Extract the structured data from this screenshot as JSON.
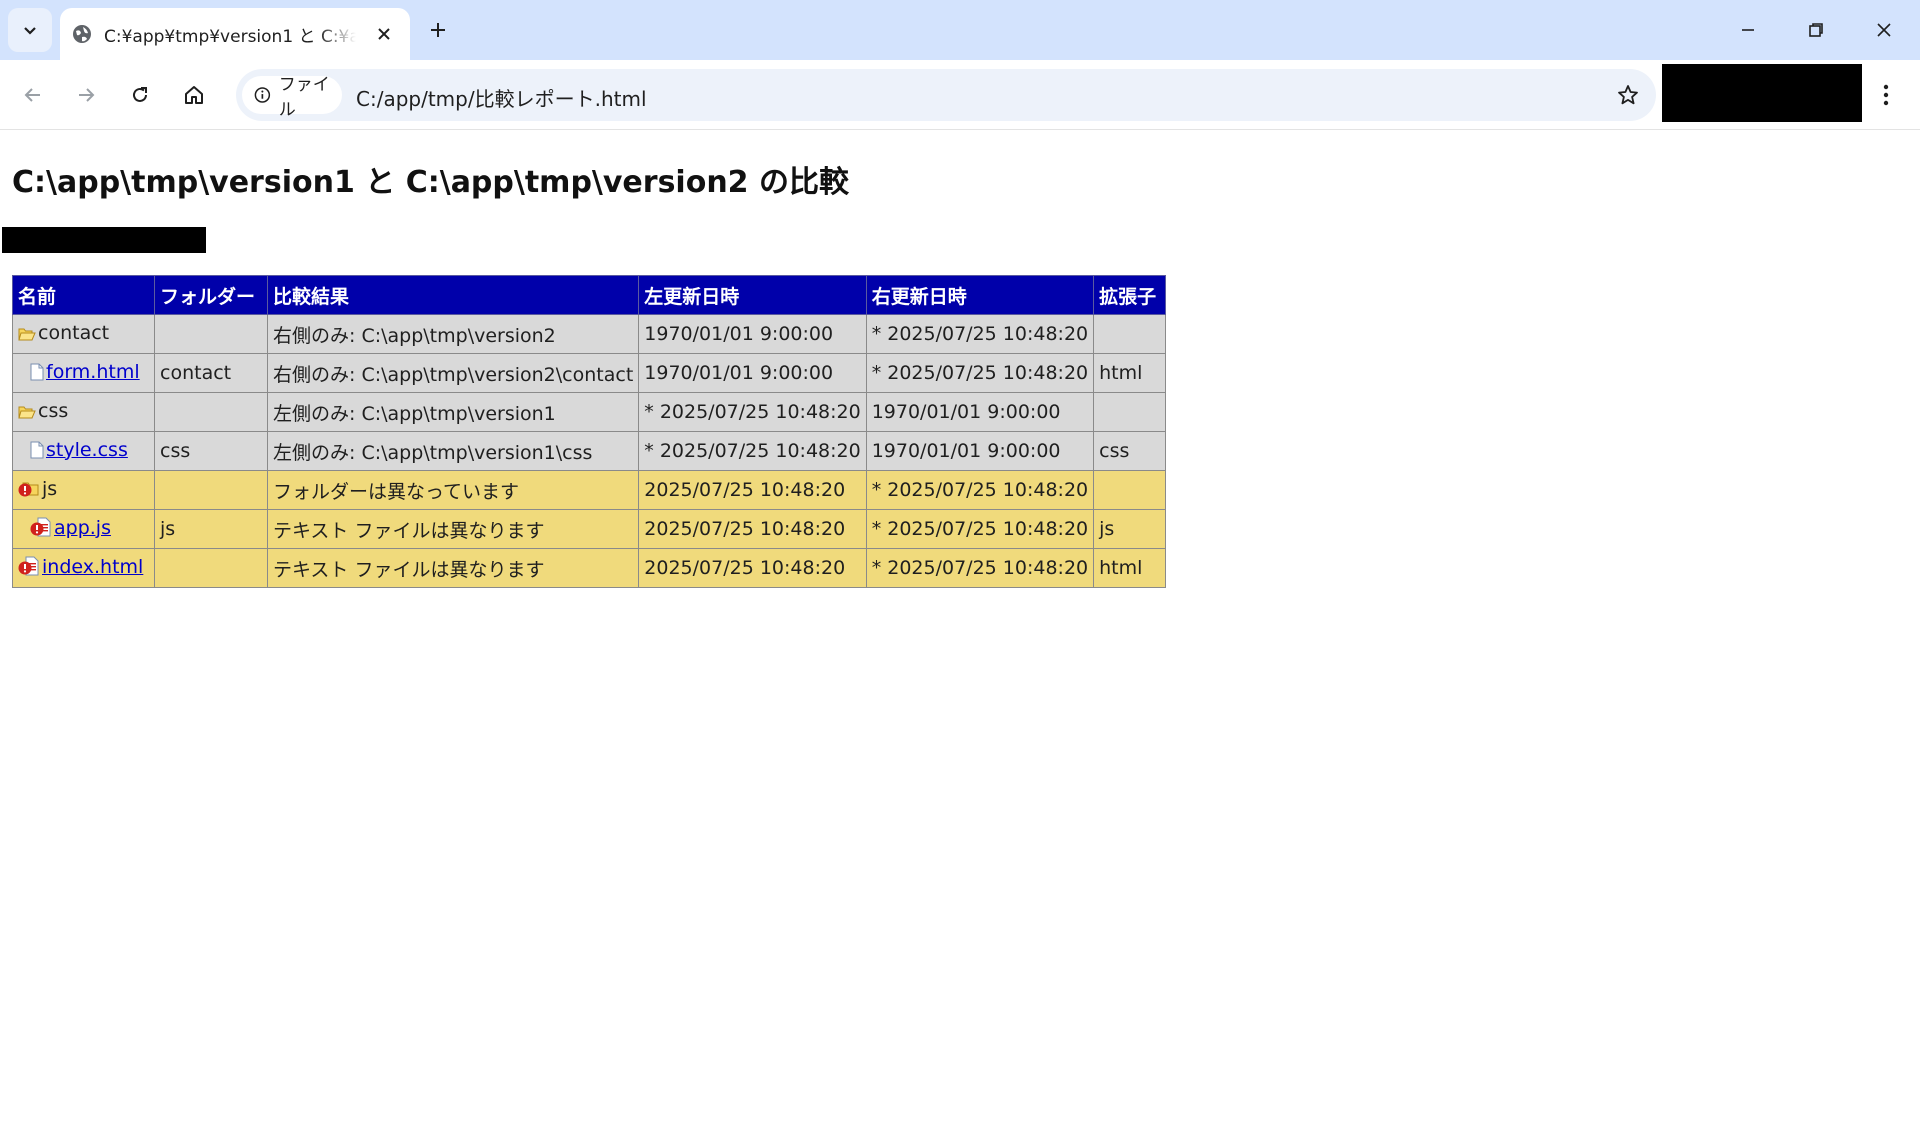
{
  "browser": {
    "tab_title": "C:¥app¥tmp¥version1 と C:¥app¥tmp¥version2 の比較",
    "chip_label": "ファイル",
    "url": "C:/app/tmp/比較レポート.html"
  },
  "page": {
    "heading": "C:\\app\\tmp\\version1 と C:\\app\\tmp\\version2 の比較"
  },
  "table": {
    "headers": [
      "名前",
      "フォルダー",
      "比較結果",
      "左更新日時",
      "右更新日時",
      "拡張子"
    ],
    "rows": [
      {
        "icon": "folder-open-icon",
        "indent": 0,
        "name": "contact",
        "link": false,
        "folder": "",
        "result": "右側のみ: C:\\app\\tmp\\version2",
        "left": "1970/01/01 9:00:00",
        "right": "* 2025/07/25 10:48:20",
        "ext": "",
        "status": "same"
      },
      {
        "icon": "file-icon",
        "indent": 1,
        "name": "form.html",
        "link": true,
        "folder": "contact",
        "result": "右側のみ: C:\\app\\tmp\\version2\\contact",
        "left": "1970/01/01 9:00:00",
        "right": "* 2025/07/25 10:48:20",
        "ext": "html",
        "status": "same"
      },
      {
        "icon": "folder-open-icon",
        "indent": 0,
        "name": "css",
        "link": false,
        "folder": "",
        "result": "左側のみ: C:\\app\\tmp\\version1",
        "left": "* 2025/07/25 10:48:20",
        "right": "1970/01/01 9:00:00",
        "ext": "",
        "status": "same"
      },
      {
        "icon": "file-icon",
        "indent": 1,
        "name": "style.css",
        "link": true,
        "folder": "css",
        "result": "左側のみ: C:\\app\\tmp\\version1\\css",
        "left": "* 2025/07/25 10:48:20",
        "right": "1970/01/01 9:00:00",
        "ext": "css",
        "status": "same"
      },
      {
        "icon": "folder-diff-icon",
        "indent": 0,
        "name": "js",
        "link": false,
        "folder": "",
        "result": "フォルダーは異なっています",
        "left": "2025/07/25 10:48:20",
        "right": "* 2025/07/25 10:48:20",
        "ext": "",
        "status": "diff"
      },
      {
        "icon": "file-diff-icon",
        "indent": 1,
        "name": "app.js",
        "link": true,
        "folder": "js",
        "result": "テキスト ファイルは異なります",
        "left": "2025/07/25 10:48:20",
        "right": "* 2025/07/25 10:48:20",
        "ext": "js",
        "status": "diff"
      },
      {
        "icon": "file-diff-icon",
        "indent": 0,
        "name": "index.html",
        "link": true,
        "folder": "",
        "result": "テキスト ファイルは異なります",
        "left": "2025/07/25 10:48:20",
        "right": "* 2025/07/25 10:48:20",
        "ext": "html",
        "status": "diff"
      }
    ]
  },
  "colors": {
    "header_bg": "#0000aa",
    "same_row_bg": "#d9d9d9",
    "diff_row_bg": "#f0da7c",
    "tabstrip_bg": "#d3e3fd"
  }
}
